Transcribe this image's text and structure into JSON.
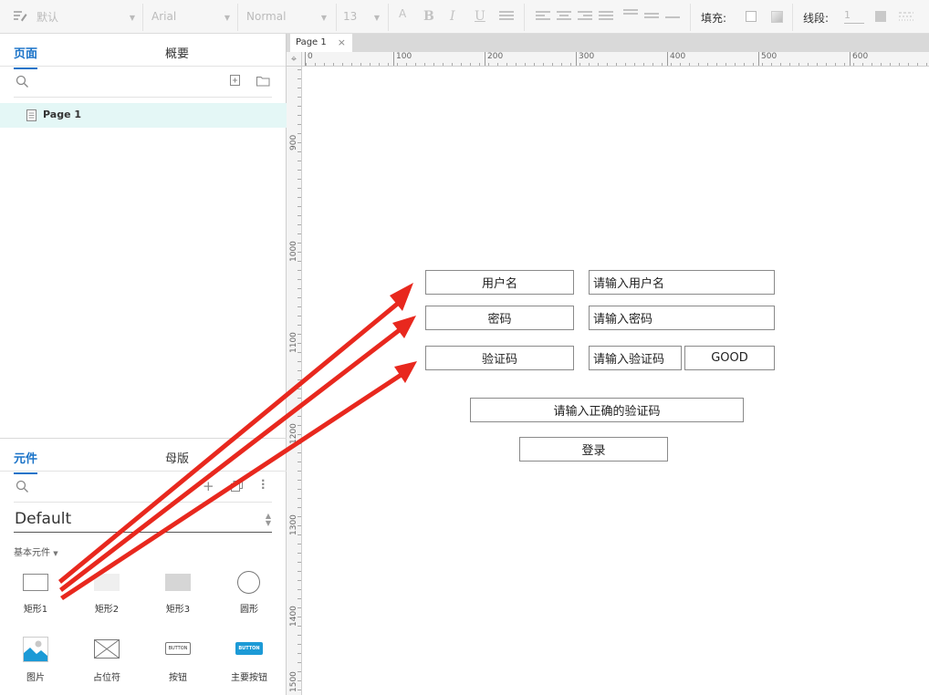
{
  "toolbar": {
    "style_value": "默认",
    "font_family": "Arial",
    "font_weight": "Normal",
    "font_size": "13",
    "fill_label": "填充:",
    "stroke_label": "线段:",
    "stroke_value": "1"
  },
  "pages_panel": {
    "tab_pages": "页面",
    "tab_outline": "概要",
    "page_item": "Page 1"
  },
  "widgets_panel": {
    "tab_widgets": "元件",
    "tab_masters": "母版",
    "library": "Default",
    "category": "基本元件",
    "items": [
      {
        "label": "矩形1",
        "icon": "rectangle-outline-icon"
      },
      {
        "label": "矩形2",
        "icon": "rectangle-light-icon"
      },
      {
        "label": "矩形3",
        "icon": "rectangle-gray-icon"
      },
      {
        "label": "圆形",
        "icon": "circle-icon"
      },
      {
        "label": "图片",
        "icon": "image-icon"
      },
      {
        "label": "占位符",
        "icon": "placeholder-icon"
      },
      {
        "label": "按钮",
        "icon": "button-icon",
        "glyph": "BUTTON"
      },
      {
        "label": "主要按钮",
        "icon": "primary-button-icon",
        "glyph": "BUTTON"
      }
    ]
  },
  "canvas": {
    "tab_label": "Page 1",
    "h_ruler_labels": [
      "0",
      "100",
      "200",
      "300",
      "400",
      "500",
      "600"
    ],
    "v_ruler_labels": [
      "900",
      "1000",
      "1100",
      "1200",
      "1300",
      "1400",
      "1500"
    ],
    "username_label": "用户名",
    "username_placeholder": "请输入用户名",
    "password_label": "密码",
    "password_placeholder": "请输入密码",
    "captcha_label": "验证码",
    "captcha_placeholder": "请输入验证码",
    "captcha_code": "GOOD",
    "captcha_error": "请输入正确的验证码",
    "login_button": "登录"
  },
  "colors": {
    "accent": "#1a73c8",
    "annotation_arrow": "#e8281e",
    "selected_row": "#e4f7f6"
  }
}
